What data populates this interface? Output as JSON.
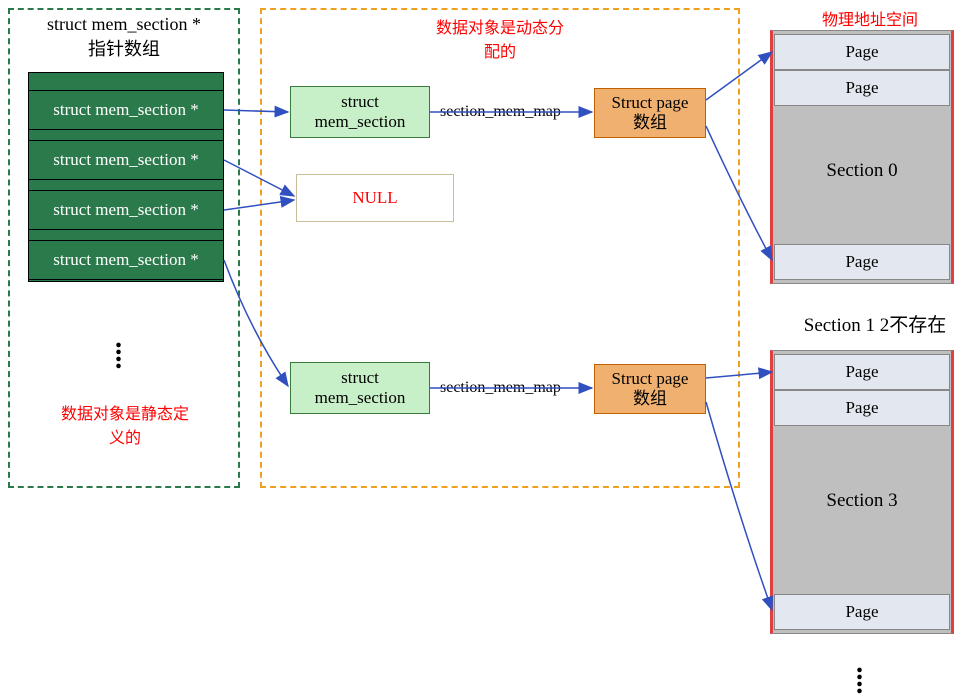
{
  "left": {
    "title_line1": "struct mem_section *",
    "title_line2": "指针数组",
    "items": [
      "struct mem_section *",
      "struct mem_section *",
      "struct mem_section *",
      "struct mem_section *"
    ],
    "note_line1": "数据对象是静态定",
    "note_line2": "义的"
  },
  "middle": {
    "note_line1": "数据对象是动态分",
    "note_line2": "配的",
    "ms_line1": "struct",
    "ms_line2": "mem_section",
    "null_label": "NULL",
    "ms2_line1": "struct",
    "ms2_line2": "mem_section",
    "edge_label": "section_mem_map",
    "sp_line1": "Struct page",
    "sp_line2": "数组"
  },
  "right": {
    "title": "物理地址空间",
    "page": "Page",
    "section0": "Section 0",
    "section_missing": "Section 1 2不存在",
    "section3": "Section 3"
  }
}
